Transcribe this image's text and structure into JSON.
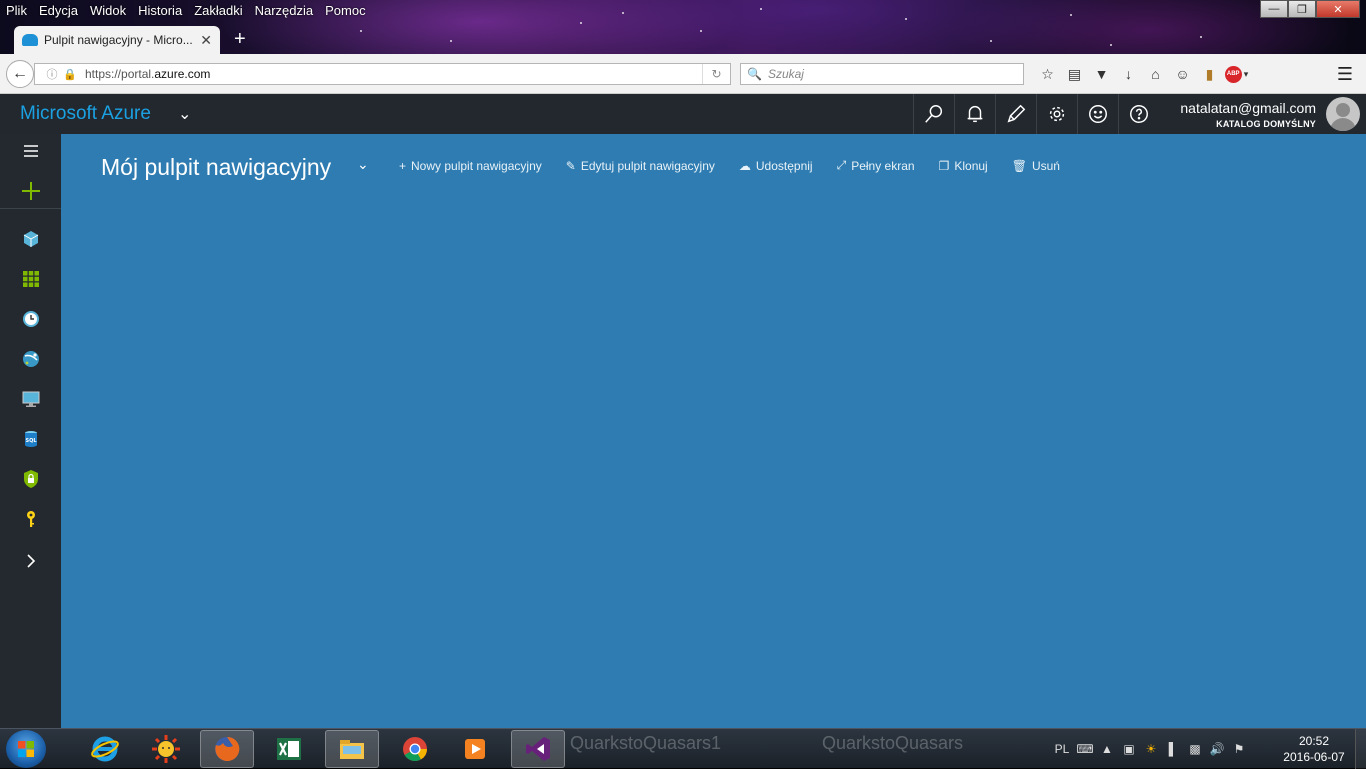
{
  "browser": {
    "menu": [
      "Plik",
      "Edycja",
      "Widok",
      "Historia",
      "Zakładki",
      "Narzędzia",
      "Pomoc"
    ],
    "tab_title": "Pulpit nawigacyjny - Micro...",
    "url_prefix": "https://portal.",
    "url_domain": "azure.com",
    "search_placeholder": "Szukaj",
    "abp_label": "ABP"
  },
  "azure": {
    "brand": "Microsoft Azure",
    "account_email": "natalatan@gmail.com",
    "account_directory": "KATALOG DOMYŚLNY",
    "accent_color": "#1ba1e2",
    "dashboard_color": "#2e7cb1"
  },
  "dashboard": {
    "title": "Mój pulpit nawigacyjny",
    "actions": {
      "new": "Nowy pulpit nawigacyjny",
      "edit": "Edytuj pulpit nawigacyjny",
      "share": "Udostępnij",
      "fullscreen": "Pełny ekran",
      "clone": "Klonuj",
      "delete": "Usuń"
    }
  },
  "taskbar": {
    "ghost_text_1": "QuarkstoQuasars1",
    "ghost_text_2": "QuarkstoQuasars",
    "language": "PL",
    "time": "20:52",
    "date": "2016-06-07"
  }
}
